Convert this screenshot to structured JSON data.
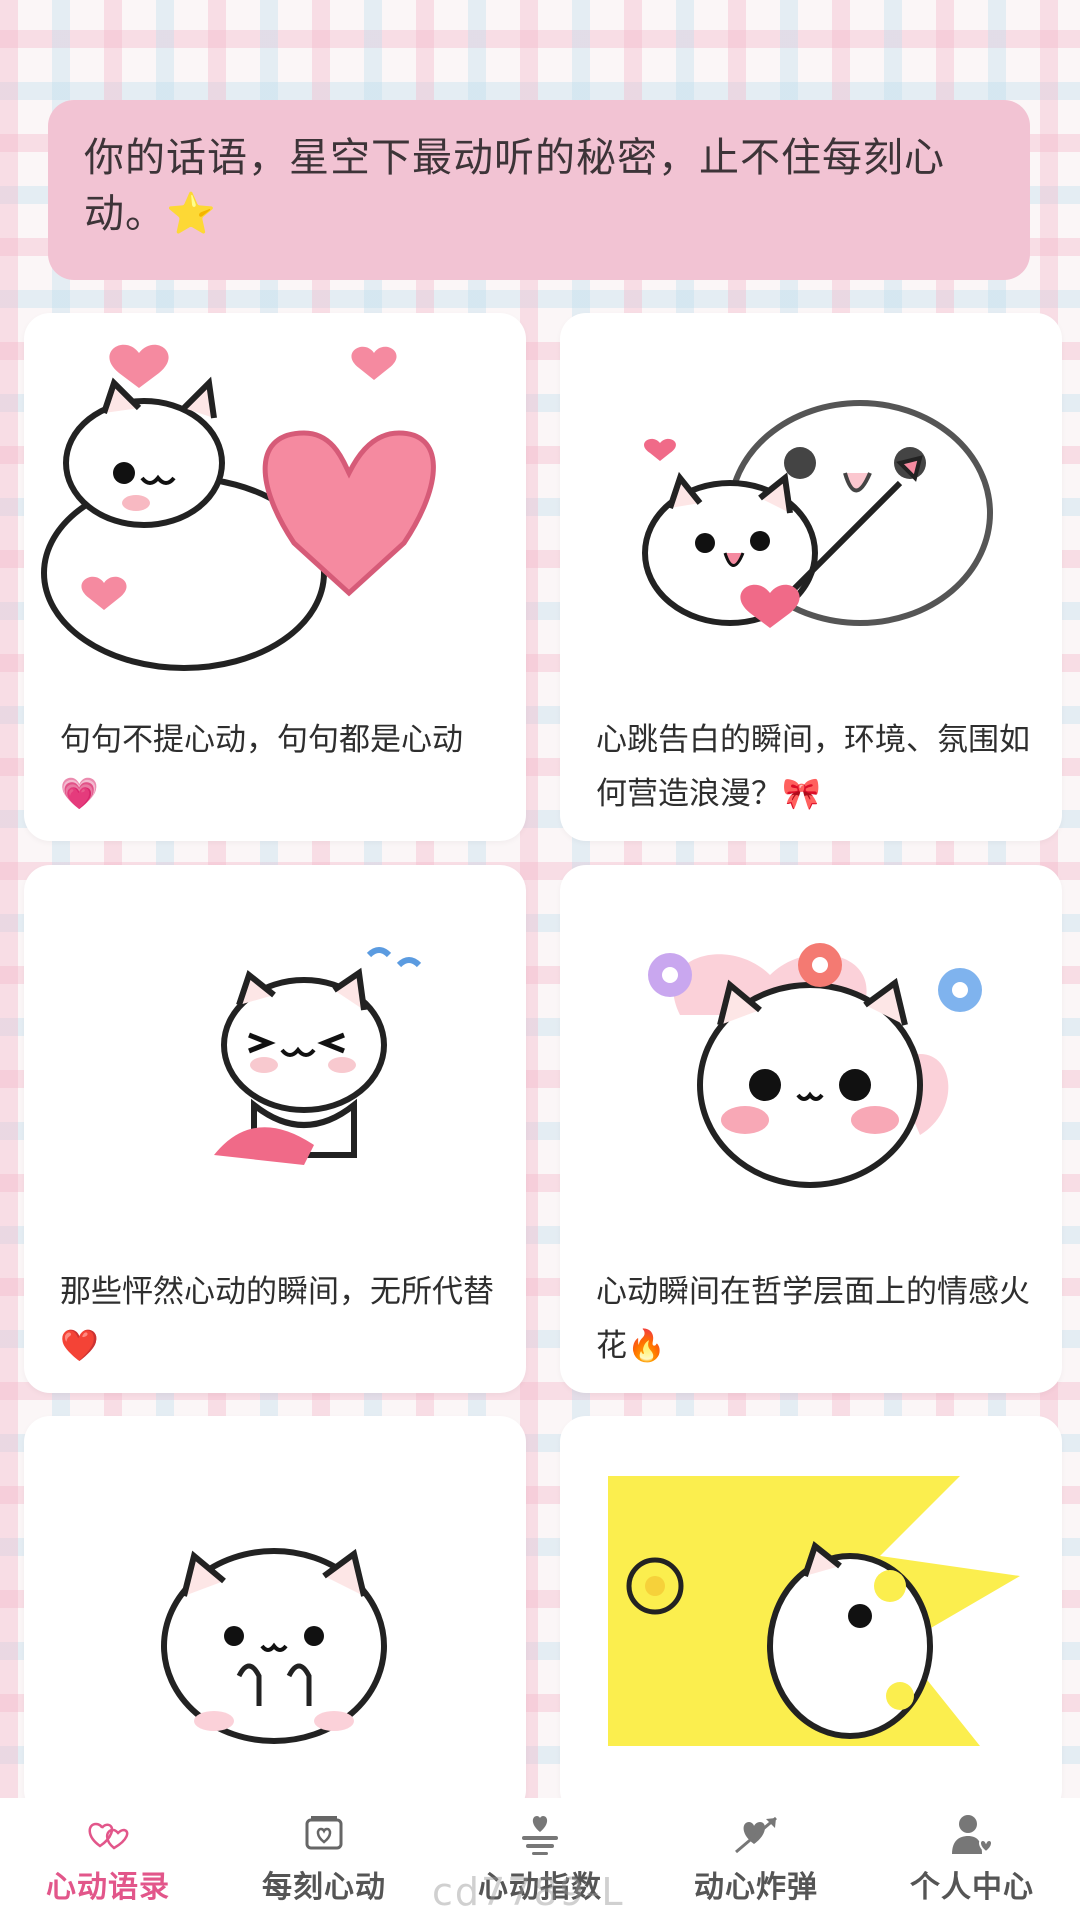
{
  "banner": {
    "text": "你的话语，星空下最动听的秘密，止不住每刻心动。⭐"
  },
  "cards": [
    {
      "caption": "句句不提心动，句句都是心动💗"
    },
    {
      "caption": "心跳告白的瞬间，环境、氛围如何营造浪漫？🎀"
    },
    {
      "caption": "那些怦然心动的瞬间，无所代替❤️"
    },
    {
      "caption": "心动瞬间在哲学层面上的情感火花🔥"
    },
    {
      "caption": ""
    },
    {
      "caption": ""
    }
  ],
  "tabs": [
    {
      "label": "心动语录",
      "icon": "hearts-icon",
      "active": true
    },
    {
      "label": "每刻心动",
      "icon": "photo-frame-heart-icon",
      "active": false
    },
    {
      "label": "心动指数",
      "icon": "heart-gauge-icon",
      "active": false
    },
    {
      "label": "动心炸弹",
      "icon": "arrow-heart-icon",
      "active": false
    },
    {
      "label": "个人中心",
      "icon": "user-heart-icon",
      "active": false
    }
  ],
  "watermark": "cd7789-L",
  "colors": {
    "accent": "#e2568a",
    "banner_bg": "#f2c3d3",
    "tab_text": "#555555"
  }
}
